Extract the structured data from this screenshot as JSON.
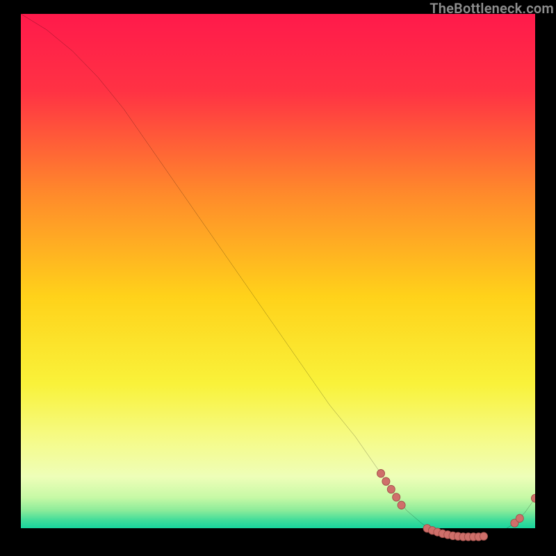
{
  "watermark": {
    "text": "TheBottleneck.com"
  },
  "colors": {
    "gradient_stops": [
      {
        "offset": 0.0,
        "color": "#ff1a4b"
      },
      {
        "offset": 0.15,
        "color": "#ff3244"
      },
      {
        "offset": 0.35,
        "color": "#ff8a2b"
      },
      {
        "offset": 0.55,
        "color": "#ffd21a"
      },
      {
        "offset": 0.72,
        "color": "#f9f23a"
      },
      {
        "offset": 0.83,
        "color": "#f5fb8a"
      },
      {
        "offset": 0.9,
        "color": "#eefeb8"
      },
      {
        "offset": 0.94,
        "color": "#c7f9a6"
      },
      {
        "offset": 0.965,
        "color": "#8dec9a"
      },
      {
        "offset": 0.985,
        "color": "#3fdc9a"
      },
      {
        "offset": 1.0,
        "color": "#17d49d"
      }
    ],
    "curve": "#000000",
    "marker_fill": "#cf6f6a",
    "marker_stroke": "#a04e49"
  },
  "chart_data": {
    "type": "line",
    "title": "",
    "xlabel": "",
    "ylabel": "",
    "xlim": [
      0,
      100
    ],
    "ylim": [
      0,
      100
    ],
    "series": [
      {
        "name": "bottleneck-curve",
        "x": [
          0,
          5,
          10,
          15,
          20,
          25,
          30,
          35,
          40,
          45,
          50,
          55,
          60,
          65,
          70,
          72,
          75,
          78,
          80,
          82,
          84,
          86,
          88,
          90,
          92,
          94,
          96,
          98,
          100
        ],
        "y": [
          100,
          97,
          93,
          88,
          82,
          75,
          68,
          61,
          54,
          47,
          40,
          33,
          26,
          20,
          13,
          10,
          6,
          3.5,
          2.2,
          1.6,
          1.2,
          1.0,
          1.0,
          1.1,
          1.5,
          2.3,
          3.6,
          5.6,
          8.3
        ]
      }
    ],
    "marker_groups": [
      {
        "name": "descent-cluster",
        "points": [
          {
            "x": 70,
            "y": 13
          },
          {
            "x": 71,
            "y": 11.5
          },
          {
            "x": 72,
            "y": 10
          },
          {
            "x": 73,
            "y": 8.5
          },
          {
            "x": 74,
            "y": 7
          }
        ]
      },
      {
        "name": "valley-cluster",
        "points": [
          {
            "x": 79,
            "y": 2.6
          },
          {
            "x": 80,
            "y": 2.2
          },
          {
            "x": 81,
            "y": 1.9
          },
          {
            "x": 82,
            "y": 1.6
          },
          {
            "x": 83,
            "y": 1.4
          },
          {
            "x": 84,
            "y": 1.2
          },
          {
            "x": 85,
            "y": 1.1
          },
          {
            "x": 86,
            "y": 1.0
          },
          {
            "x": 87,
            "y": 1.0
          },
          {
            "x": 88,
            "y": 1.0
          },
          {
            "x": 89,
            "y": 1.0
          },
          {
            "x": 90,
            "y": 1.1
          }
        ]
      },
      {
        "name": "rise-cluster",
        "points": [
          {
            "x": 96,
            "y": 3.6
          },
          {
            "x": 97,
            "y": 4.5
          }
        ]
      },
      {
        "name": "end-point",
        "points": [
          {
            "x": 100,
            "y": 8.3
          }
        ]
      }
    ]
  }
}
